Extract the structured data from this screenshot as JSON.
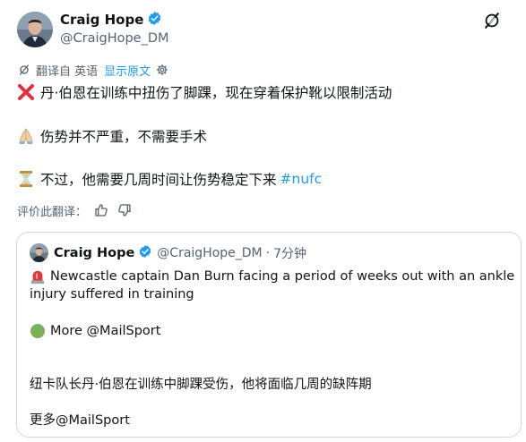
{
  "tweet": {
    "author_name": "Craig Hope",
    "author_handle": "@CraigHope_DM",
    "translation": {
      "label": "翻译自 英语",
      "show_original": "显示原文"
    },
    "lines": [
      "丹·伯恩在训练中扭伤了脚踝，现在穿着保护靴以限制活动",
      "伤势并不严重，不需要手术",
      "不过，他需要几周时间让伤势稳定下来"
    ],
    "hashtag": "#nufc",
    "rate_label": "评价此翻译："
  },
  "quoted_tweet": {
    "author_name": "Craig Hope",
    "author_handle": "@CraigHope_DM",
    "separator": "·",
    "time": "7分钟",
    "line1": "Newcastle captain Dan Burn facing a period of weeks out with an ankle",
    "line2": "injury suffered in training",
    "more": "More @MailSport",
    "zh_line": "纽卡队长丹·伯恩在训练中脚踝受伤，他将面临几周的缺阵期",
    "zh_more": "更多@MailSport"
  },
  "colors": {
    "link": "#1d9bf0",
    "verified": "#1d9bf0",
    "muted": "#536471",
    "border": "#cfd9de"
  },
  "icons": [
    "verified-badge-icon",
    "grok-icon",
    "translate-icon",
    "gear-icon",
    "red-x-emoji",
    "praying-hands-emoji",
    "hourglass-emoji",
    "thumbs-up-icon",
    "thumbs-down-icon",
    "siren-emoji",
    "green-circle-emoji"
  ]
}
